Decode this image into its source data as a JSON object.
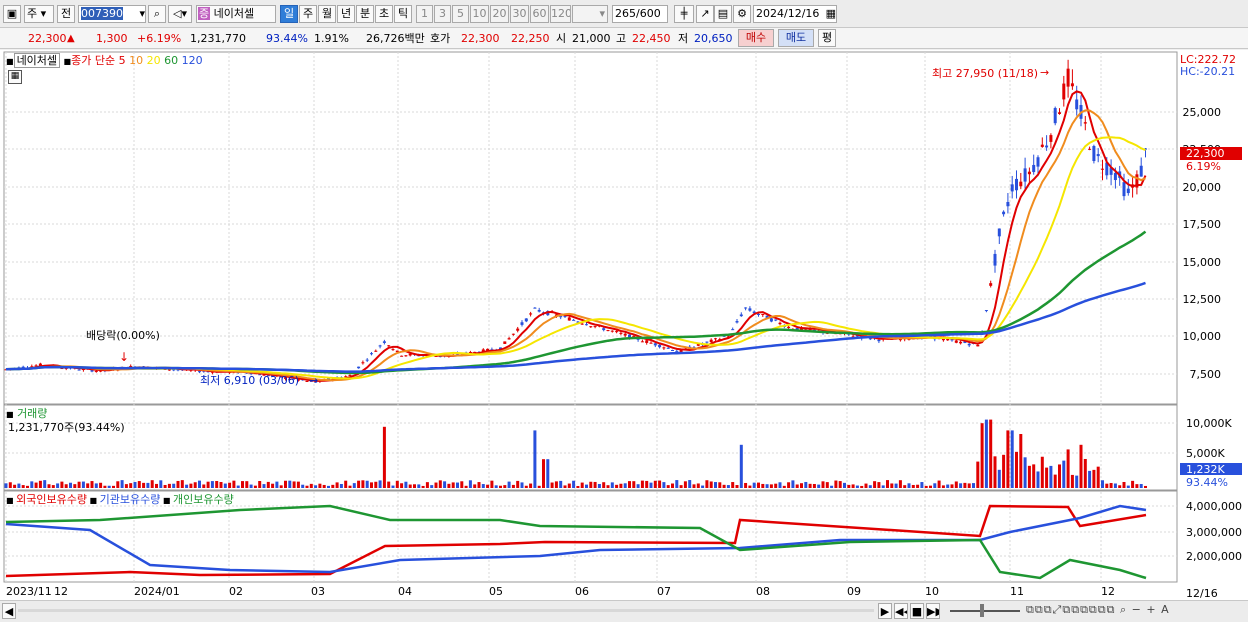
{
  "toolbar": {
    "market_label": "주",
    "prev_label": "전",
    "stock_code": "007390",
    "stock_badge": "증",
    "stock_name": "네이처셀",
    "period_tabs": [
      "일",
      "주",
      "월",
      "년",
      "분",
      "초",
      "틱"
    ],
    "active_period": "일",
    "interval_buttons": [
      "1",
      "3",
      "5",
      "10",
      "20",
      "30",
      "60",
      "120"
    ],
    "count_value": "265",
    "count_total": "/600",
    "date_value": "2024/12/16"
  },
  "quote": {
    "price": "22,300",
    "change": "1,300",
    "change_rate": "+6.19%",
    "volume": "1,231,770",
    "volume_rate": "93.44%",
    "turnover": "1.91%",
    "amount": "26,726백만",
    "ask_label": "호가",
    "ask": "22,300",
    "bid": "22,250",
    "open_label": "시",
    "open": "21,000",
    "high_label": "고",
    "high": "22,450",
    "low_label": "저",
    "low": "20,650",
    "buy_label": "매수",
    "sell_label": "매도",
    "eval_label": "평"
  },
  "price_panel": {
    "stock_label": "네이처셀",
    "ma_title": "종가 단순",
    "ma_periods": [
      "5",
      "10",
      "20",
      "60",
      "120"
    ],
    "ma_colors": [
      "#e00000",
      "#f08c1e",
      "#f5e600",
      "#1e9632",
      "#2850dc"
    ],
    "lc_label": "LC:222.72",
    "hc_label": "HC:-20.21",
    "yticks": [
      "25,000",
      "22,500",
      "20,000",
      "17,500",
      "15,000",
      "12,500",
      "10,000",
      "7,500"
    ],
    "last_price_tag": "22,300",
    "last_rate_tag": "6.19%",
    "high_annotation": "최고 27,950 (11/18)",
    "low_annotation": "최저 6,910 (03/06)",
    "dividend_annotation": "배당락(0.00%)"
  },
  "volume_panel": {
    "title": "거래량",
    "value": "1,231,770주(93.44%)",
    "yticks": [
      "10,000K",
      "5,000K"
    ],
    "last_tag": "1,232K",
    "last_rate": "93.44%"
  },
  "holding_panel": {
    "series": [
      "외국인보유수량",
      "기관보유수량",
      "개인보유수량"
    ],
    "series_colors": [
      "#e00000",
      "#2850dc",
      "#1e9632"
    ],
    "yticks": [
      "4,000,000",
      "3,000,000",
      "2,000,000"
    ]
  },
  "xaxis": {
    "labels": [
      "2023/11",
      "12",
      "2024/01",
      "02",
      "03",
      "04",
      "05",
      "06",
      "07",
      "08",
      "09",
      "10",
      "11",
      "12"
    ],
    "end_label": "12/16"
  }
}
